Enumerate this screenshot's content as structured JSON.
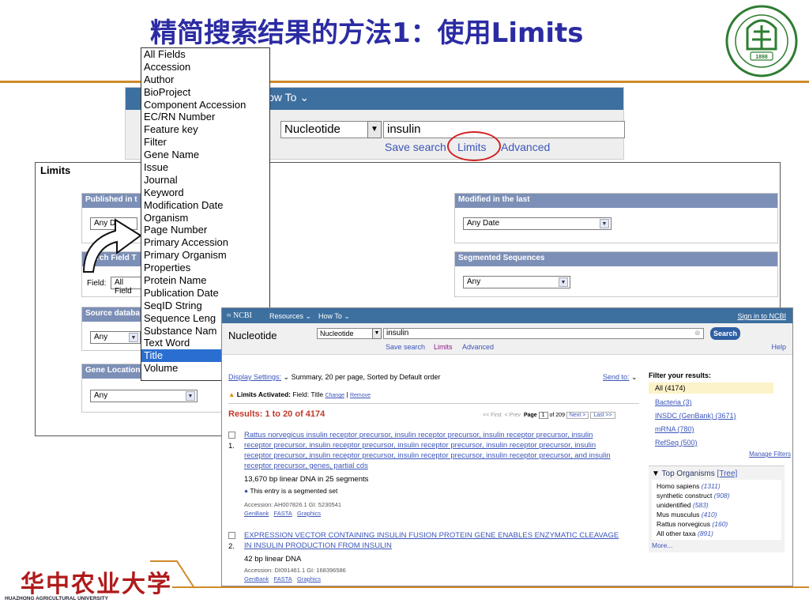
{
  "slide": {
    "title": "精简搜索结果的方法1：使用Limits",
    "logo_text": "1898",
    "university_zh": "华中农业大学",
    "university_en": "HUAZHONG AGRICULTURAL UNIVERSITY"
  },
  "top_search": {
    "howto": "How To",
    "database": "Nucleotide",
    "term": "insulin",
    "links": {
      "save_search": "Save search",
      "limits": "Limits",
      "advanced": "Advanced"
    }
  },
  "limits_panel": {
    "title": "Limits",
    "published": {
      "header": "Published in t",
      "value": "Any Da"
    },
    "modified": {
      "header": "Modified in the last",
      "value": "Any Date"
    },
    "search_field": {
      "header": "rch Field T",
      "label": "Field:",
      "value": "All Field"
    },
    "segmented": {
      "header": "Segmented Sequences",
      "value": "Any"
    },
    "source_db": {
      "header": "Source databa",
      "value": "Any"
    },
    "gene_location": {
      "header": "Gene Location",
      "value": "Any"
    }
  },
  "field_list": {
    "items": [
      "All Fields",
      "Accession",
      "Author",
      "BioProject",
      "Component Accession",
      "EC/RN Number",
      "Feature key",
      "Filter",
      "Gene Name",
      "Issue",
      "Journal",
      "Keyword",
      "Modification Date",
      "Organism",
      "Page Number",
      "Primary Accession",
      "Primary Organism",
      "Properties",
      "Protein Name",
      "Publication Date",
      "SeqID String",
      "Sequence Leng",
      "Substance Nam",
      "Text Word",
      "Title",
      "Volume"
    ],
    "selected": "Title"
  },
  "results": {
    "nav": {
      "ncbi": "NCBI",
      "resources": "Resources",
      "howto": "How To",
      "sign_in": "Sign in to NCBI"
    },
    "db_label": "Nucleotide",
    "db_select": "Nucleotide",
    "term": "insulin",
    "search_btn": "Search",
    "links": {
      "save_search": "Save search",
      "limits": "Limits",
      "advanced": "Advanced",
      "help": "Help"
    },
    "display_settings": "Display Settings:",
    "display_summary": "Summary, 20 per page, Sorted by Default order",
    "send_to": "Send to:",
    "limits_activated": "Limits Activated:",
    "limits_field": "Field: Title",
    "change": "Change",
    "remove": "Remove",
    "results_count": "Results: 1 to 20 of 4174",
    "pager": {
      "first": "<< First",
      "prev": "< Prev",
      "page_label": "Page",
      "page": "1",
      "of": "of 209",
      "next": "Next >",
      "last": "Last >>"
    },
    "item1": {
      "num": "1.",
      "title_l1": "Rattus norvegicus insulin receptor precursor, insulin receptor precursor, insulin receptor precursor, insulin",
      "title_l2": "receptor precursor, insulin receptor precursor, insulin receptor precursor, insulin receptor precursor, insulin",
      "title_l3": "receptor precursor, insulin receptor precursor, insulin receptor precursor, insulin receptor precursor, and insulin",
      "title_l4": "receptor precursor, genes, partial cds",
      "desc": "13,670 bp linear DNA in 25 segments",
      "note": "This entry is a segmented set",
      "accession": "Accession: AH007826.1 GI: 5230541",
      "links": [
        "GenBank",
        "FASTA",
        "Graphics"
      ]
    },
    "item2": {
      "num": "2.",
      "title_l1": "EXPRESSION VECTOR CONTAINING INSULIN FUSION PROTEIN GENE ENABLES ENZYMATIC CLEAVAGE",
      "title_l2": "IN INSULIN PRODUCTION FROM INSULIN",
      "desc": "42 bp linear DNA",
      "accession": "Accession: DI091461.1 GI: 168396586",
      "links": [
        "GenBank",
        "FASTA",
        "Graphics"
      ]
    },
    "filter": {
      "title": "Filter your results:",
      "items": [
        "All (4174)",
        "Bacteria (3)",
        "INSDC (GenBank) (3671)",
        "mRNA (780)",
        "RefSeq (500)"
      ],
      "manage": "Manage Filters"
    },
    "top_organisms": {
      "title": "Top Organisms",
      "tree": "[Tree]",
      "items": [
        {
          "name": "Homo sapiens",
          "count": "(1311)"
        },
        {
          "name": "synthetic construct",
          "count": "(908)"
        },
        {
          "name": "unidentified",
          "count": "(583)"
        },
        {
          "name": "Mus musculus",
          "count": "(410)"
        },
        {
          "name": "Rattus norvegicus",
          "count": "(160)"
        },
        {
          "name": "All other taxa",
          "count": "(891)"
        }
      ],
      "more": "More..."
    }
  }
}
